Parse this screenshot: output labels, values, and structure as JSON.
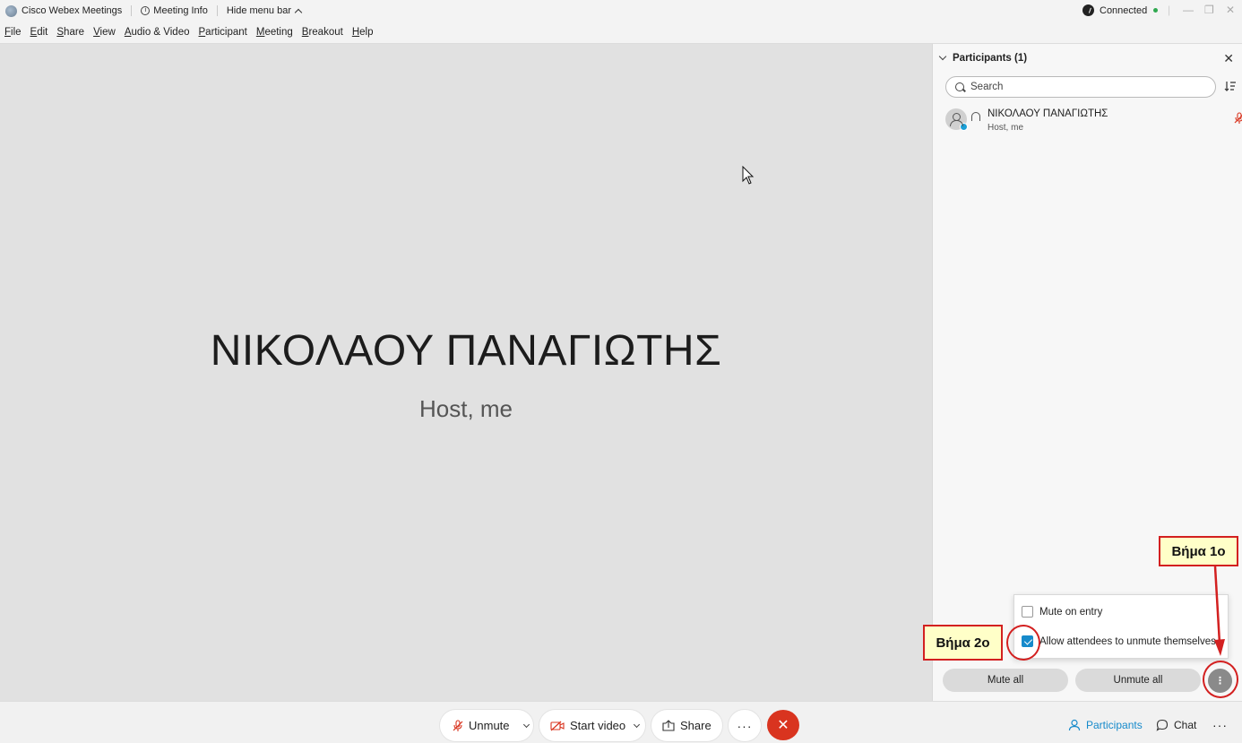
{
  "titlebar": {
    "app_name": "Cisco Webex Meetings",
    "meeting_info": "Meeting Info",
    "hide_menu": "Hide menu bar",
    "status": "Connected",
    "status_color": "#2fa84f"
  },
  "menubar": {
    "items": [
      {
        "u": "F",
        "rest": "ile"
      },
      {
        "u": "E",
        "rest": "dit"
      },
      {
        "u": "S",
        "rest": "hare"
      },
      {
        "u": "V",
        "rest": "iew"
      },
      {
        "u": "A",
        "rest": "udio & Video"
      },
      {
        "u": "P",
        "rest": "articipant"
      },
      {
        "u": "M",
        "rest": "eeting"
      },
      {
        "u": "B",
        "rest": "reakout"
      },
      {
        "u": "H",
        "rest": "elp"
      }
    ]
  },
  "stage": {
    "name": "ΝΙΚΟΛΑΟΥ ΠΑΝΑΓΙΩΤΗΣ",
    "role": "Host, me"
  },
  "panel": {
    "title": "Participants (1)",
    "search_placeholder": "Search",
    "participant": {
      "name": "ΝΙΚΟΛΑΟΥ ΠΑΝΑΓΙΩΤΗΣ",
      "role": "Host, me"
    },
    "options": {
      "mute_on_entry": "Mute on entry",
      "mute_on_entry_checked": false,
      "allow_unmute": "Allow attendees to unmute themselves",
      "allow_unmute_checked": true
    },
    "mute_all": "Mute all",
    "unmute_all": "Unmute all"
  },
  "toolbar": {
    "unmute": "Unmute",
    "start_video": "Start video",
    "share": "Share",
    "participants": "Participants",
    "chat": "Chat",
    "accent": "#168acb",
    "end_color": "#d9341f"
  },
  "callouts": {
    "step1": "Βήμα 1ο",
    "step2": "Βήμα 2ο"
  }
}
